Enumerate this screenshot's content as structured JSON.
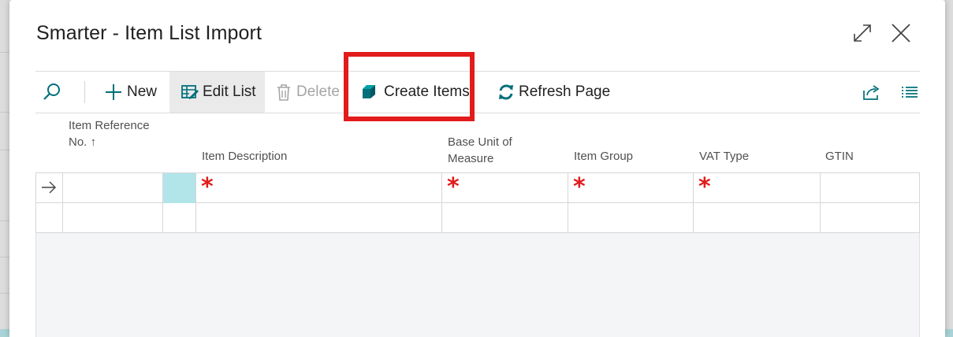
{
  "dialog": {
    "title": "Smarter - Item List Import"
  },
  "toolbar": {
    "search_icon": "search-icon",
    "new_label": "New",
    "edit_list_label": "Edit List",
    "delete_label": "Delete",
    "create_items_label": "Create Items",
    "refresh_label": "Refresh Page",
    "share_icon": "share-icon",
    "list_view_icon": "list-view-icon"
  },
  "grid": {
    "columns": [
      {
        "label": "Item Reference No. ↑"
      },
      {
        "label": "Item Description"
      },
      {
        "label": "Base Unit of Measure"
      },
      {
        "label": "Item Group"
      },
      {
        "label": "VAT Type"
      },
      {
        "label": "GTIN"
      }
    ],
    "required_marker": "*"
  },
  "colors": {
    "accent": "#00707a",
    "highlight": "#e21b1b",
    "selected_cell": "#b2e5ea"
  }
}
